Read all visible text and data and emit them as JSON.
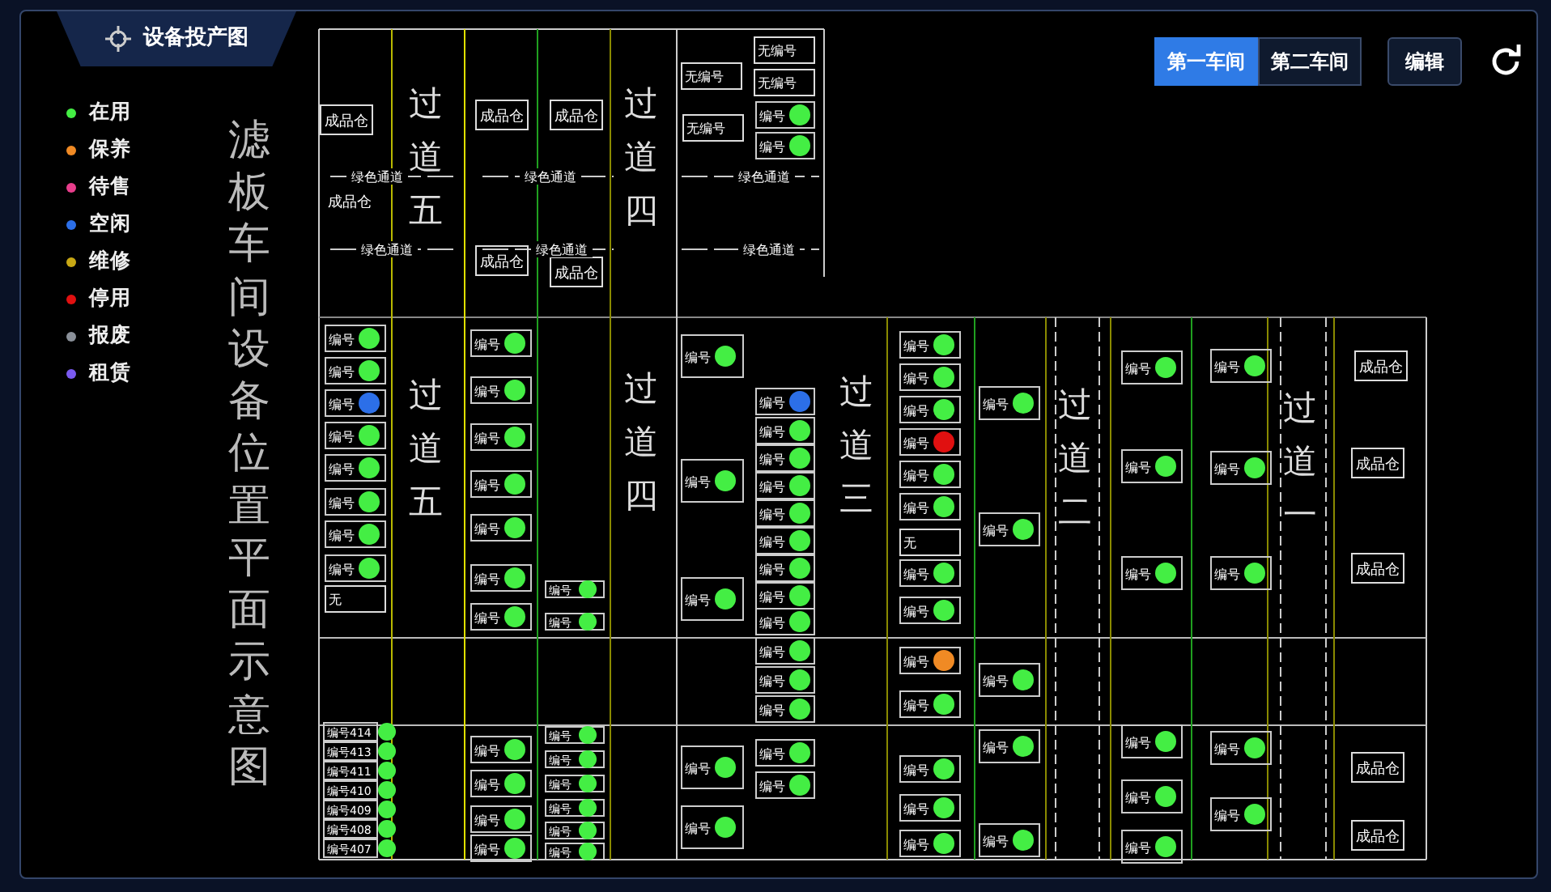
{
  "header": {
    "title": "设备投产图"
  },
  "legend": [
    {
      "label": "在用",
      "color": "#44ee44"
    },
    {
      "label": "保养",
      "color": "#f08a24"
    },
    {
      "label": "待售",
      "color": "#e83e8c"
    },
    {
      "label": "空闲",
      "color": "#2c6fe8"
    },
    {
      "label": "维修",
      "color": "#c8a814"
    },
    {
      "label": "停用",
      "color": "#e01010"
    },
    {
      "label": "报废",
      "color": "#8a9099"
    },
    {
      "label": "租赁",
      "color": "#7a5af0"
    }
  ],
  "workshops": [
    {
      "label": "第一车间",
      "selected": true
    },
    {
      "label": "第二车间",
      "selected": false
    }
  ],
  "edit_button": "编辑",
  "plan": {
    "title": "滤板车间设备位置平面示意图",
    "aisles": [
      "过道五",
      "过道四",
      "过道五",
      "过道四",
      "过道三",
      "过道二",
      "过道一"
    ],
    "storage_labels": [
      "成品仓",
      "成品仓",
      "成品仓",
      "成品仓",
      "成品仓",
      "成品仓",
      "成品仓",
      "成品仓",
      "成品仓",
      "成品仓",
      "成品仓"
    ],
    "channel_labels": [
      "绿色通道",
      "绿色通道",
      "绿色通道",
      "绿色通道",
      "绿色通道",
      "绿色通道"
    ],
    "tags": [
      "无编号",
      "无编号",
      "无编号",
      "无编号",
      "无",
      "无"
    ],
    "devices": [
      {
        "label": "编号",
        "color": "#44ee44"
      },
      {
        "label": "编号",
        "color": "#44ee44"
      },
      {
        "label": "编号",
        "color": "#44ee44"
      },
      {
        "label": "编号",
        "color": "#44ee44"
      },
      {
        "label": "编号",
        "color": "#2c6fe8"
      },
      {
        "label": "编号",
        "color": "#44ee44"
      },
      {
        "label": "编号",
        "color": "#44ee44"
      },
      {
        "label": "编号",
        "color": "#44ee44"
      },
      {
        "label": "编号",
        "color": "#44ee44"
      },
      {
        "label": "编号",
        "color": "#44ee44"
      },
      {
        "label": "编号",
        "color": "#44ee44"
      },
      {
        "label": "编号",
        "color": "#44ee44"
      },
      {
        "label": "编号",
        "color": "#44ee44"
      },
      {
        "label": "编号",
        "color": "#44ee44"
      },
      {
        "label": "编号",
        "color": "#44ee44"
      },
      {
        "label": "编号",
        "color": "#44ee44"
      },
      {
        "label": "编号",
        "color": "#44ee44"
      },
      {
        "label": "编号",
        "color": "#44ee44"
      },
      {
        "label": "编号",
        "color": "#44ee44"
      },
      {
        "label": "编号",
        "color": "#44ee44"
      },
      {
        "label": "编号",
        "color": "#44ee44"
      },
      {
        "label": "编号",
        "color": "#44ee44"
      },
      {
        "label": "编号",
        "color": "#2c6fe8"
      },
      {
        "label": "编号",
        "color": "#44ee44"
      },
      {
        "label": "编号",
        "color": "#44ee44"
      },
      {
        "label": "编号",
        "color": "#44ee44"
      },
      {
        "label": "编号",
        "color": "#44ee44"
      },
      {
        "label": "编号",
        "color": "#44ee44"
      },
      {
        "label": "编号",
        "color": "#44ee44"
      },
      {
        "label": "编号",
        "color": "#44ee44"
      },
      {
        "label": "编号",
        "color": "#44ee44"
      },
      {
        "label": "编号",
        "color": "#44ee44"
      },
      {
        "label": "编号",
        "color": "#44ee44"
      },
      {
        "label": "编号",
        "color": "#44ee44"
      },
      {
        "label": "编号",
        "color": "#44ee44"
      },
      {
        "label": "编号",
        "color": "#44ee44"
      },
      {
        "label": "编号",
        "color": "#44ee44"
      },
      {
        "label": "编号",
        "color": "#e01010"
      },
      {
        "label": "编号",
        "color": "#44ee44"
      },
      {
        "label": "编号",
        "color": "#44ee44"
      },
      {
        "label": "编号",
        "color": "#44ee44"
      },
      {
        "label": "编号",
        "color": "#44ee44"
      },
      {
        "label": "编号",
        "color": "#f08a24"
      },
      {
        "label": "编号",
        "color": "#44ee44"
      },
      {
        "label": "编号",
        "color": "#44ee44"
      },
      {
        "label": "编号",
        "color": "#44ee44"
      },
      {
        "label": "编号",
        "color": "#44ee44"
      },
      {
        "label": "编号",
        "color": "#44ee44"
      },
      {
        "label": "编号",
        "color": "#44ee44"
      },
      {
        "label": "编号",
        "color": "#44ee44"
      },
      {
        "label": "编号",
        "color": "#44ee44"
      },
      {
        "label": "编号",
        "color": "#44ee44"
      },
      {
        "label": "编号",
        "color": "#44ee44"
      },
      {
        "label": "编号414",
        "color": "#44ee44"
      },
      {
        "label": "编号413",
        "color": "#44ee44"
      },
      {
        "label": "编号411",
        "color": "#44ee44"
      },
      {
        "label": "编号410",
        "color": "#44ee44"
      },
      {
        "label": "编号409",
        "color": "#44ee44"
      },
      {
        "label": "编号408",
        "color": "#44ee44"
      },
      {
        "label": "编号407",
        "color": "#44ee44"
      },
      {
        "label": "编号",
        "color": "#44ee44"
      },
      {
        "label": "编号",
        "color": "#44ee44"
      },
      {
        "label": "编号",
        "color": "#44ee44"
      },
      {
        "label": "编号",
        "color": "#44ee44"
      },
      {
        "label": "编号",
        "color": "#44ee44"
      },
      {
        "label": "编号",
        "color": "#44ee44"
      },
      {
        "label": "编号",
        "color": "#44ee44"
      },
      {
        "label": "编号",
        "color": "#44ee44"
      },
      {
        "label": "编号",
        "color": "#44ee44"
      },
      {
        "label": "编号",
        "color": "#44ee44"
      },
      {
        "label": "编号",
        "color": "#44ee44"
      },
      {
        "label": "编号",
        "color": "#44ee44"
      },
      {
        "label": "编号",
        "color": "#44ee44"
      },
      {
        "label": "编号",
        "color": "#44ee44"
      },
      {
        "label": "编号",
        "color": "#44ee44"
      },
      {
        "label": "编号",
        "color": "#44ee44"
      },
      {
        "label": "编号",
        "color": "#44ee44"
      },
      {
        "label": "编号",
        "color": "#44ee44"
      },
      {
        "label": "编号",
        "color": "#44ee44"
      },
      {
        "label": "编号",
        "color": "#44ee44"
      },
      {
        "label": "编号",
        "color": "#44ee44"
      },
      {
        "label": "编号",
        "color": "#44ee44"
      },
      {
        "label": "编号",
        "color": "#44ee44"
      },
      {
        "label": "编号",
        "color": "#44ee44"
      }
    ]
  }
}
